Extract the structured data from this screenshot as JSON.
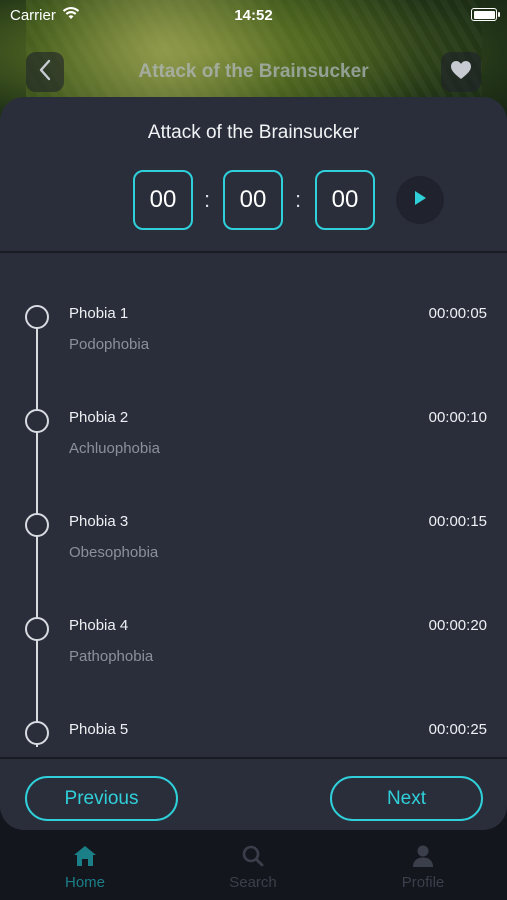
{
  "status_bar": {
    "carrier": "Carrier",
    "time": "14:52"
  },
  "nav": {
    "title": "Attack of the Brainsucker"
  },
  "panel": {
    "title": "Attack of the Brainsucker",
    "timer": {
      "hours": "00",
      "minutes": "00",
      "seconds": "00",
      "separator": ":"
    }
  },
  "phobias": [
    {
      "name": "Phobia 1",
      "subtitle": "Podophobia",
      "time": "00:00:05"
    },
    {
      "name": "Phobia 2",
      "subtitle": "Achluophobia",
      "time": "00:00:10"
    },
    {
      "name": "Phobia 3",
      "subtitle": "Obesophobia",
      "time": "00:00:15"
    },
    {
      "name": "Phobia 4",
      "subtitle": "Pathophobia",
      "time": "00:00:20"
    },
    {
      "name": "Phobia 5",
      "subtitle": "",
      "time": "00:00:25"
    }
  ],
  "buttons": {
    "previous": "Previous",
    "next": "Next"
  },
  "tabs": [
    {
      "label": "Home",
      "icon": "home-icon",
      "active": true
    },
    {
      "label": "Search",
      "icon": "search-icon",
      "active": false
    },
    {
      "label": "Profile",
      "icon": "profile-icon",
      "active": false
    }
  ],
  "colors": {
    "accent": "#2fd0d9",
    "panel": "#2a2e3b",
    "tab_active": "#1b7f88",
    "tab_inactive": "#3a3f4b"
  }
}
